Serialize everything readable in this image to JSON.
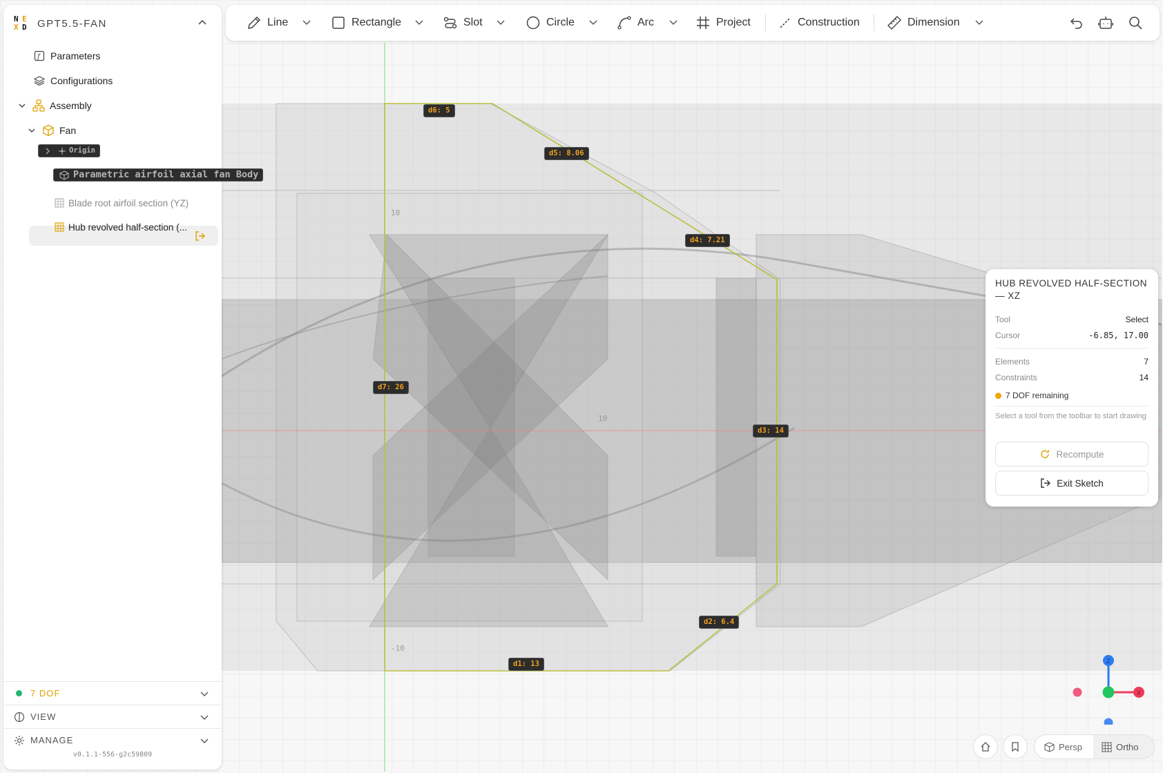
{
  "app": {
    "title": "GPT5.5-FAN",
    "logo_letters": [
      "N",
      "E",
      "X",
      "D"
    ]
  },
  "sidebar": {
    "top_items": [
      {
        "label": "Parameters",
        "icon": "function-icon"
      },
      {
        "label": "Configurations",
        "icon": "layers-icon"
      }
    ],
    "tree": {
      "assembly": {
        "label": "Assembly",
        "icon": "assembly-icon"
      },
      "fan": {
        "label": "Fan",
        "icon": "part-cube-icon"
      },
      "children": [
        {
          "label": "Origin",
          "icon": "origin-icon"
        },
        {
          "label": "Parametric airfoil axial fan Body",
          "icon": "body-icon"
        },
        {
          "label": "Blade root airfoil section (YZ)",
          "icon": "sketch-icon"
        },
        {
          "label": "Hub revolved half-section (...",
          "icon": "sketch-active-icon"
        }
      ]
    },
    "footer": {
      "dof_label": "7 DOF",
      "view_label": "VIEW",
      "manage_label": "MANAGE",
      "version": "v0.1.1-556-g2c59809"
    }
  },
  "toolbar": {
    "tools": [
      {
        "label": "Line",
        "icon": "pencil-icon"
      },
      {
        "label": "Rectangle",
        "icon": "rectangle-icon"
      },
      {
        "label": "Slot",
        "icon": "slot-icon"
      },
      {
        "label": "Circle",
        "icon": "circle-icon"
      },
      {
        "label": "Arc",
        "icon": "arc-icon"
      },
      {
        "label": "Project",
        "icon": "project-icon"
      },
      {
        "label": "Construction",
        "icon": "construction-icon"
      },
      {
        "label": "Dimension",
        "icon": "ruler-icon"
      }
    ],
    "actions": [
      "undo-icon",
      "robot-icon",
      "search-icon"
    ]
  },
  "canvas": {
    "dimensions": [
      "d6: 5",
      "d5: 8.06",
      "d4: 7.21",
      "d7: 26",
      "d3: 14",
      "d2: 6.4",
      "d1: 13"
    ],
    "grid_labels": [
      "10",
      "10",
      "-10"
    ],
    "axis_labels": {
      "z": "Z",
      "x": "X"
    }
  },
  "panel": {
    "title": "HUB REVOLVED HALF-SECTION — XZ",
    "tool_key": "Tool",
    "tool_value": "Select",
    "cursor_key": "Cursor",
    "cursor_value": "-6.85, 17.00",
    "elements_key": "Elements",
    "elements_value": "7",
    "constraints_key": "Constraints",
    "constraints_value": "14",
    "dof_text": "7 DOF remaining",
    "hint": "Select a tool from the toolbar to start drawing",
    "recompute_label": "Recompute",
    "exit_label": "Exit Sketch"
  },
  "view_controls": {
    "persp_label": "Persp",
    "ortho_label": "Ortho",
    "active": "Ortho"
  },
  "colors": {
    "accent": "#f0a500",
    "dof_ok": "#22b573",
    "dim_text": "#f0a020",
    "sketch_line": "#b8c040"
  }
}
